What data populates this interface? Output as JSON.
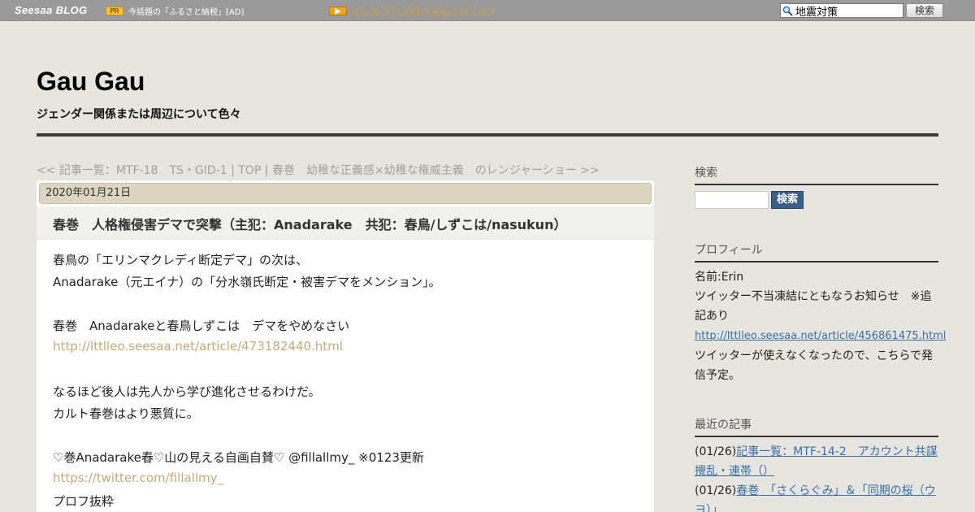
{
  "topbar": {
    "brand_main": "Seesaa",
    "brand_sub": "BLOG",
    "pr_badge": "PR",
    "pr_text": "今話題の「ふるさと納税」[AD]",
    "notice": "まとめブログ続々追加されてます",
    "search_value": "地震対策",
    "search_button": "検索"
  },
  "header": {
    "title": "Gau Gau",
    "description": "ジェンダー関係または周辺について色々"
  },
  "nav": {
    "prev": "<< 記事一覧：MTF-18　TS・GID-1",
    "sep1": " | ",
    "top": "TOP",
    "sep2": " | ",
    "next": "春巻　幼稚な正義感×幼稚な権威主義　のレンジャーショー >>"
  },
  "article": {
    "date": "2020年01月21日",
    "title": "春巻　人格権侵害デマで突撃（主犯：Anadarake　共犯：春鳥/しずこは/nasukun）",
    "lines": [
      "春鳥の「エリンマクレディ断定デマ」の次は、",
      "Anadarake（元エイナ）の「分水嶺氏断定・被害デマをメンション」。",
      "春巻　Anadarakeと春鳥しずこは　デマをやめなさい",
      "http://lttlleo.seesaa.net/article/473182440.html",
      "なるほど後人は先人から学び進化させるわけだ。",
      "カルト春巻はより悪質に。",
      "♡巻Anadarake春♡山の見える自画自賛♡ @fillallmy_ ※0123更新",
      "https://twitter.com/fillallmy_",
      "プロフ抜粋"
    ]
  },
  "sidebar": {
    "search_heading": "検索",
    "search_button": "検索",
    "profile_heading": "プロフィール",
    "profile_name": "名前:Erin",
    "profile_note": "ツイッター不当凍結にともなうお知らせ　※追記あり",
    "profile_link": "http://lttlleo.seesaa.net/article/456861475.html",
    "profile_after": "ツイッターが使えなくなったので、こちらで発信予定。",
    "recent_heading": "最近の記事",
    "recent": [
      {
        "date": "(01/26)",
        "title": "記事一覧：MTF-14-2　アカウント共謀攪乱・連帯（）"
      },
      {
        "date": "(01/26)",
        "title": "春巻　「さくらぐみ」＆「同期の桜（ウヨ）」"
      }
    ]
  },
  "colors": {
    "topbar": "#9a9a9a",
    "page_bg": "#e6e5e0",
    "date_bar": "#dcd6c0",
    "link_body": "#c4a97a",
    "link_side": "#3b6ea5",
    "side_button": "#3b5e86"
  }
}
